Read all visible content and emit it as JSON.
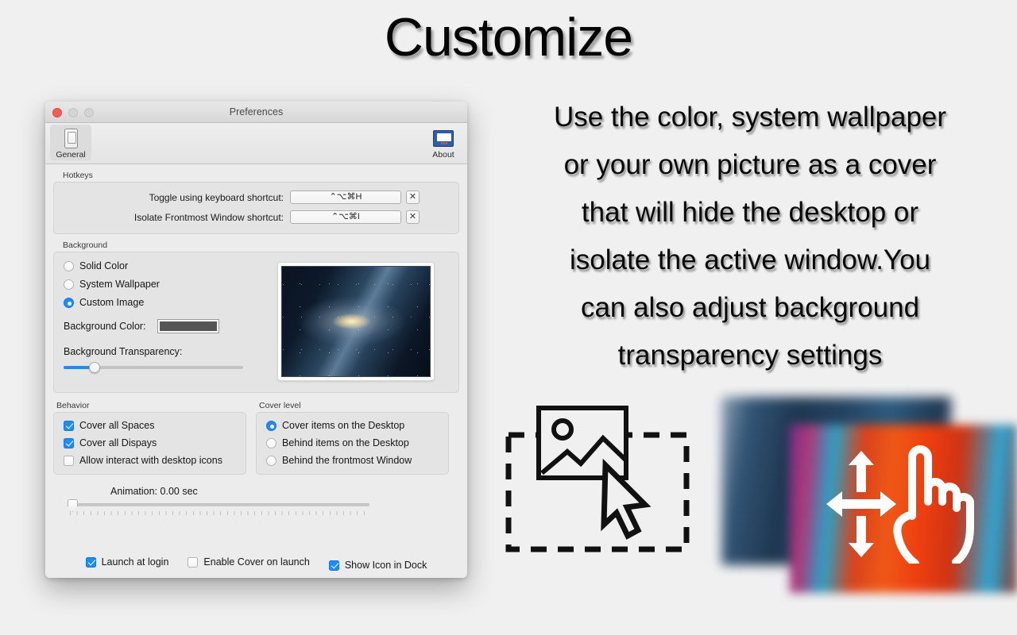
{
  "hero": {
    "title": "Customize",
    "paragraph_lines": [
      "Use the color, system wallpaper",
      "or your own picture as a cover",
      "that will hide the desktop or",
      "isolate the active window.You",
      "can also adjust background",
      "transparency settings"
    ]
  },
  "window": {
    "title": "Preferences",
    "traffic_lights": {
      "close": "close-button",
      "minimize": "minimize-button",
      "zoom": "zoom-button"
    },
    "toolbar": [
      {
        "label": "General",
        "icon": "light-switch-icon",
        "selected": true
      },
      {
        "label": "About",
        "icon": "monitor-icon",
        "selected": false
      }
    ],
    "hotkeys": {
      "group_label": "Hotkeys",
      "rows": [
        {
          "label": "Toggle using keyboard shortcut:",
          "value": "⌃⌥⌘H",
          "clear": "✕"
        },
        {
          "label": "Isolate Frontmost Window shortcut:",
          "value": "⌃⌥⌘I",
          "clear": "✕"
        }
      ]
    },
    "background": {
      "group_label": "Background",
      "options": [
        {
          "label": "Solid Color",
          "selected": false
        },
        {
          "label": "System Wallpaper",
          "selected": false
        },
        {
          "label": "Custom Image",
          "selected": true
        }
      ],
      "color_label": "Background Color:",
      "color_value": "#555555",
      "transparency_label": "Background Transparency:",
      "transparency_percent": 18,
      "preview_alt": "galaxy-wallpaper-preview"
    },
    "behavior": {
      "group_label": "Behavior",
      "items": [
        {
          "label": "Cover all Spaces",
          "checked": true
        },
        {
          "label": "Cover all Dispays",
          "checked": true
        },
        {
          "label": "Allow interact with desktop icons",
          "checked": false
        }
      ]
    },
    "cover_level": {
      "group_label": "Cover level",
      "items": [
        {
          "label": "Cover items on the Desktop",
          "selected": true
        },
        {
          "label": "Behind items on the Desktop",
          "selected": false
        },
        {
          "label": "Behind the frontmost Window",
          "selected": false
        }
      ]
    },
    "animation": {
      "label": "Animation: 0.00 sec",
      "value_percent": 0
    },
    "bottom_options": [
      {
        "label": "Launch at login",
        "checked": true
      },
      {
        "label": "Enable Cover on launch",
        "checked": false
      },
      {
        "label": "Show Icon in Dock",
        "checked": true
      }
    ]
  },
  "artwork": {
    "image_cursor": "image-placeholder-cursor-icon",
    "blurred_pair": "blurred-wallpaper-pair",
    "move_hand": "move-arrows-hand-icon"
  },
  "colors": {
    "accent": "#1e8bfc",
    "page_bg": "#f0f0f0",
    "window_bg": "#ececec",
    "close_light": "#fa5e57"
  }
}
